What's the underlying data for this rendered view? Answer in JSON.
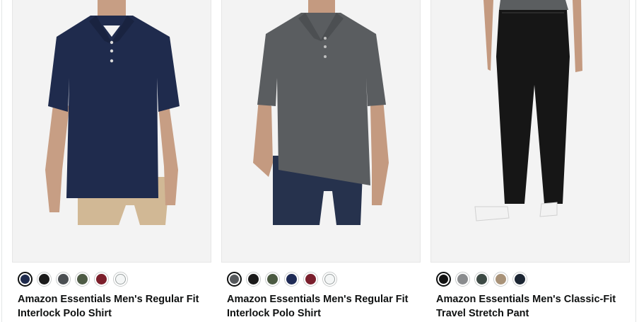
{
  "products": [
    {
      "title": "Amazon Essentials Men's Regular Fit Interlock Polo Shirt",
      "image_alt": "navy-polo-shirt-on-model",
      "selected_swatch": 0,
      "swatches": [
        "#1f2b4d",
        "#1b1b1b",
        "#4b4f52",
        "#4e5b45",
        "#7c1f2b",
        "#f4f6f6"
      ]
    },
    {
      "title": "Amazon Essentials Men's Regular Fit Interlock Polo Shirt",
      "image_alt": "charcoal-heather-polo-shirt-on-model",
      "selected_swatch": 0,
      "swatches": [
        "#56595c",
        "#1a1a1a",
        "#4b5a42",
        "#1f2b56",
        "#7a1f2d",
        "#f4f6f6"
      ]
    },
    {
      "title": "Amazon Essentials Men's Classic-Fit Travel Stretch Pant",
      "image_alt": "black-travel-stretch-pant-on-model",
      "selected_swatch": 0,
      "swatches": [
        "#121212",
        "#8a8c8e",
        "#3d4a45",
        "#a89278",
        "#1c2633"
      ]
    }
  ]
}
